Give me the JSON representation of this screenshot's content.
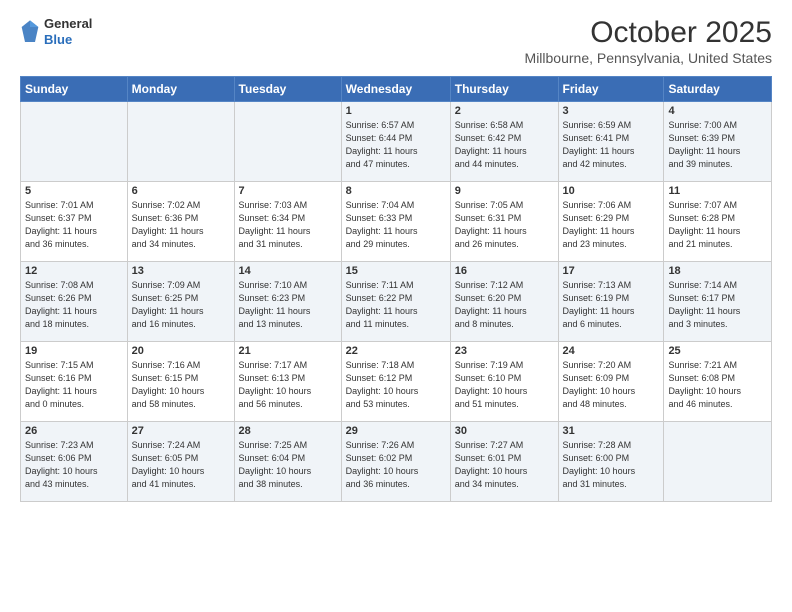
{
  "header": {
    "logo": {
      "line1": "General",
      "line2": "Blue"
    },
    "title": "October 2025",
    "location": "Millbourne, Pennsylvania, United States"
  },
  "days_of_week": [
    "Sunday",
    "Monday",
    "Tuesday",
    "Wednesday",
    "Thursday",
    "Friday",
    "Saturday"
  ],
  "weeks": [
    [
      {
        "day": "",
        "info": ""
      },
      {
        "day": "",
        "info": ""
      },
      {
        "day": "",
        "info": ""
      },
      {
        "day": "1",
        "info": "Sunrise: 6:57 AM\nSunset: 6:44 PM\nDaylight: 11 hours\nand 47 minutes."
      },
      {
        "day": "2",
        "info": "Sunrise: 6:58 AM\nSunset: 6:42 PM\nDaylight: 11 hours\nand 44 minutes."
      },
      {
        "day": "3",
        "info": "Sunrise: 6:59 AM\nSunset: 6:41 PM\nDaylight: 11 hours\nand 42 minutes."
      },
      {
        "day": "4",
        "info": "Sunrise: 7:00 AM\nSunset: 6:39 PM\nDaylight: 11 hours\nand 39 minutes."
      }
    ],
    [
      {
        "day": "5",
        "info": "Sunrise: 7:01 AM\nSunset: 6:37 PM\nDaylight: 11 hours\nand 36 minutes."
      },
      {
        "day": "6",
        "info": "Sunrise: 7:02 AM\nSunset: 6:36 PM\nDaylight: 11 hours\nand 34 minutes."
      },
      {
        "day": "7",
        "info": "Sunrise: 7:03 AM\nSunset: 6:34 PM\nDaylight: 11 hours\nand 31 minutes."
      },
      {
        "day": "8",
        "info": "Sunrise: 7:04 AM\nSunset: 6:33 PM\nDaylight: 11 hours\nand 29 minutes."
      },
      {
        "day": "9",
        "info": "Sunrise: 7:05 AM\nSunset: 6:31 PM\nDaylight: 11 hours\nand 26 minutes."
      },
      {
        "day": "10",
        "info": "Sunrise: 7:06 AM\nSunset: 6:29 PM\nDaylight: 11 hours\nand 23 minutes."
      },
      {
        "day": "11",
        "info": "Sunrise: 7:07 AM\nSunset: 6:28 PM\nDaylight: 11 hours\nand 21 minutes."
      }
    ],
    [
      {
        "day": "12",
        "info": "Sunrise: 7:08 AM\nSunset: 6:26 PM\nDaylight: 11 hours\nand 18 minutes."
      },
      {
        "day": "13",
        "info": "Sunrise: 7:09 AM\nSunset: 6:25 PM\nDaylight: 11 hours\nand 16 minutes."
      },
      {
        "day": "14",
        "info": "Sunrise: 7:10 AM\nSunset: 6:23 PM\nDaylight: 11 hours\nand 13 minutes."
      },
      {
        "day": "15",
        "info": "Sunrise: 7:11 AM\nSunset: 6:22 PM\nDaylight: 11 hours\nand 11 minutes."
      },
      {
        "day": "16",
        "info": "Sunrise: 7:12 AM\nSunset: 6:20 PM\nDaylight: 11 hours\nand 8 minutes."
      },
      {
        "day": "17",
        "info": "Sunrise: 7:13 AM\nSunset: 6:19 PM\nDaylight: 11 hours\nand 6 minutes."
      },
      {
        "day": "18",
        "info": "Sunrise: 7:14 AM\nSunset: 6:17 PM\nDaylight: 11 hours\nand 3 minutes."
      }
    ],
    [
      {
        "day": "19",
        "info": "Sunrise: 7:15 AM\nSunset: 6:16 PM\nDaylight: 11 hours\nand 0 minutes."
      },
      {
        "day": "20",
        "info": "Sunrise: 7:16 AM\nSunset: 6:15 PM\nDaylight: 10 hours\nand 58 minutes."
      },
      {
        "day": "21",
        "info": "Sunrise: 7:17 AM\nSunset: 6:13 PM\nDaylight: 10 hours\nand 56 minutes."
      },
      {
        "day": "22",
        "info": "Sunrise: 7:18 AM\nSunset: 6:12 PM\nDaylight: 10 hours\nand 53 minutes."
      },
      {
        "day": "23",
        "info": "Sunrise: 7:19 AM\nSunset: 6:10 PM\nDaylight: 10 hours\nand 51 minutes."
      },
      {
        "day": "24",
        "info": "Sunrise: 7:20 AM\nSunset: 6:09 PM\nDaylight: 10 hours\nand 48 minutes."
      },
      {
        "day": "25",
        "info": "Sunrise: 7:21 AM\nSunset: 6:08 PM\nDaylight: 10 hours\nand 46 minutes."
      }
    ],
    [
      {
        "day": "26",
        "info": "Sunrise: 7:23 AM\nSunset: 6:06 PM\nDaylight: 10 hours\nand 43 minutes."
      },
      {
        "day": "27",
        "info": "Sunrise: 7:24 AM\nSunset: 6:05 PM\nDaylight: 10 hours\nand 41 minutes."
      },
      {
        "day": "28",
        "info": "Sunrise: 7:25 AM\nSunset: 6:04 PM\nDaylight: 10 hours\nand 38 minutes."
      },
      {
        "day": "29",
        "info": "Sunrise: 7:26 AM\nSunset: 6:02 PM\nDaylight: 10 hours\nand 36 minutes."
      },
      {
        "day": "30",
        "info": "Sunrise: 7:27 AM\nSunset: 6:01 PM\nDaylight: 10 hours\nand 34 minutes."
      },
      {
        "day": "31",
        "info": "Sunrise: 7:28 AM\nSunset: 6:00 PM\nDaylight: 10 hours\nand 31 minutes."
      },
      {
        "day": "",
        "info": ""
      }
    ]
  ]
}
